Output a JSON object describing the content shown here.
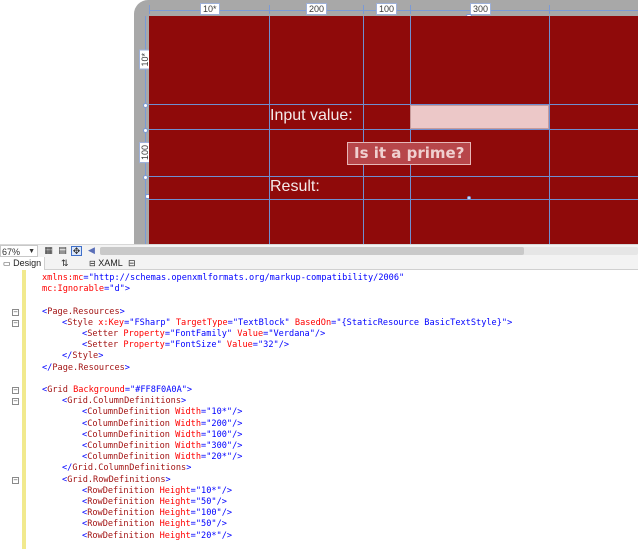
{
  "designer": {
    "column_widths": [
      "10*",
      "200",
      "100",
      "300"
    ],
    "row_heights": [
      "10*",
      "100"
    ],
    "input_label": "Input value:",
    "button_label": "Is it a prime?",
    "result_label": "Result:",
    "background_color": "#8f0a0a"
  },
  "toolbar": {
    "zoom": "67%",
    "fit_icon": "fit-to-window-icon",
    "grid_icon": "grid-icon",
    "snap_icon": "snap-to-grid-icon",
    "scroll_left_icon": "triangle-left-icon"
  },
  "view_tabs": {
    "design": "Design",
    "swap": "⇅",
    "xaml": "XAML",
    "collapse": "⊟"
  },
  "code": {
    "lines": [
      {
        "parts": [
          [
            "attr",
            "xmlns:mc"
          ],
          [
            "punct",
            "="
          ],
          [
            "val",
            "\"http://schemas.openxmlformats.org/markup-compatibility/2006\""
          ]
        ],
        "indent": 0
      },
      {
        "parts": [
          [
            "attr",
            "mc:Ignorable"
          ],
          [
            "punct",
            "="
          ],
          [
            "val",
            "\"d\""
          ],
          [
            "punct",
            ">"
          ]
        ],
        "indent": 0
      },
      {
        "parts": [],
        "indent": 0
      },
      {
        "parts": [
          [
            "punct",
            "<"
          ],
          [
            "tag",
            "Page.Resources"
          ],
          [
            "punct",
            ">"
          ]
        ],
        "indent": 0,
        "fold": true
      },
      {
        "parts": [
          [
            "punct",
            "<"
          ],
          [
            "tag",
            "Style"
          ],
          [
            "attr",
            " x:Key"
          ],
          [
            "punct",
            "="
          ],
          [
            "val",
            "\"FSharp\""
          ],
          [
            "attr",
            " TargetType"
          ],
          [
            "punct",
            "="
          ],
          [
            "val",
            "\"TextBlock\""
          ],
          [
            "attr",
            " BasedOn"
          ],
          [
            "punct",
            "="
          ],
          [
            "val",
            "\"{StaticResource BasicTextStyle}\""
          ],
          [
            "punct",
            ">"
          ]
        ],
        "indent": 1,
        "fold": true
      },
      {
        "parts": [
          [
            "punct",
            "<"
          ],
          [
            "tag",
            "Setter"
          ],
          [
            "attr",
            " Property"
          ],
          [
            "punct",
            "="
          ],
          [
            "val",
            "\"FontFamily\""
          ],
          [
            "attr",
            " Value"
          ],
          [
            "punct",
            "="
          ],
          [
            "val",
            "\"Verdana\""
          ],
          [
            "punct",
            "/>"
          ]
        ],
        "indent": 2
      },
      {
        "parts": [
          [
            "punct",
            "<"
          ],
          [
            "tag",
            "Setter"
          ],
          [
            "attr",
            " Property"
          ],
          [
            "punct",
            "="
          ],
          [
            "val",
            "\"FontSize\""
          ],
          [
            "attr",
            " Value"
          ],
          [
            "punct",
            "="
          ],
          [
            "val",
            "\"32\""
          ],
          [
            "punct",
            "/>"
          ]
        ],
        "indent": 2
      },
      {
        "parts": [
          [
            "punct",
            "</"
          ],
          [
            "tag",
            "Style"
          ],
          [
            "punct",
            ">"
          ]
        ],
        "indent": 1
      },
      {
        "parts": [
          [
            "punct",
            "</"
          ],
          [
            "tag",
            "Page.Resources"
          ],
          [
            "punct",
            ">"
          ]
        ],
        "indent": 0
      },
      {
        "parts": [],
        "indent": 0
      },
      {
        "parts": [
          [
            "punct",
            "<"
          ],
          [
            "tag",
            "Grid"
          ],
          [
            "attr",
            " Background"
          ],
          [
            "punct",
            "="
          ],
          [
            "val",
            "\"#FF8F0A0A\""
          ],
          [
            "punct",
            ">"
          ]
        ],
        "indent": 0,
        "fold": true
      },
      {
        "parts": [
          [
            "punct",
            "<"
          ],
          [
            "tag",
            "Grid.ColumnDefinitions"
          ],
          [
            "punct",
            ">"
          ]
        ],
        "indent": 1,
        "fold": true
      },
      {
        "parts": [
          [
            "punct",
            "<"
          ],
          [
            "tag",
            "ColumnDefinition"
          ],
          [
            "attr",
            " Width"
          ],
          [
            "punct",
            "="
          ],
          [
            "val",
            "\"10*\""
          ],
          [
            "punct",
            "/>"
          ]
        ],
        "indent": 2
      },
      {
        "parts": [
          [
            "punct",
            "<"
          ],
          [
            "tag",
            "ColumnDefinition"
          ],
          [
            "attr",
            " Width"
          ],
          [
            "punct",
            "="
          ],
          [
            "val",
            "\"200\""
          ],
          [
            "punct",
            "/>"
          ]
        ],
        "indent": 2
      },
      {
        "parts": [
          [
            "punct",
            "<"
          ],
          [
            "tag",
            "ColumnDefinition"
          ],
          [
            "attr",
            " Width"
          ],
          [
            "punct",
            "="
          ],
          [
            "val",
            "\"100\""
          ],
          [
            "punct",
            "/>"
          ]
        ],
        "indent": 2
      },
      {
        "parts": [
          [
            "punct",
            "<"
          ],
          [
            "tag",
            "ColumnDefinition"
          ],
          [
            "attr",
            " Width"
          ],
          [
            "punct",
            "="
          ],
          [
            "val",
            "\"300\""
          ],
          [
            "punct",
            "/>"
          ]
        ],
        "indent": 2
      },
      {
        "parts": [
          [
            "punct",
            "<"
          ],
          [
            "tag",
            "ColumnDefinition"
          ],
          [
            "attr",
            " Width"
          ],
          [
            "punct",
            "="
          ],
          [
            "val",
            "\"20*\""
          ],
          [
            "punct",
            "/>"
          ]
        ],
        "indent": 2
      },
      {
        "parts": [
          [
            "punct",
            "</"
          ],
          [
            "tag",
            "Grid.ColumnDefinitions"
          ],
          [
            "punct",
            ">"
          ]
        ],
        "indent": 1
      },
      {
        "parts": [
          [
            "punct",
            "<"
          ],
          [
            "tag",
            "Grid.RowDefinitions"
          ],
          [
            "punct",
            ">"
          ]
        ],
        "indent": 1,
        "fold": true
      },
      {
        "parts": [
          [
            "punct",
            "<"
          ],
          [
            "tag",
            "RowDefinition"
          ],
          [
            "attr",
            " Height"
          ],
          [
            "punct",
            "="
          ],
          [
            "val",
            "\"10*\""
          ],
          [
            "punct",
            "/>"
          ]
        ],
        "indent": 2
      },
      {
        "parts": [
          [
            "punct",
            "<"
          ],
          [
            "tag",
            "RowDefinition"
          ],
          [
            "attr",
            " Height"
          ],
          [
            "punct",
            "="
          ],
          [
            "val",
            "\"50\""
          ],
          [
            "punct",
            "/>"
          ]
        ],
        "indent": 2
      },
      {
        "parts": [
          [
            "punct",
            "<"
          ],
          [
            "tag",
            "RowDefinition"
          ],
          [
            "attr",
            " Height"
          ],
          [
            "punct",
            "="
          ],
          [
            "val",
            "\"100\""
          ],
          [
            "punct",
            "/>"
          ]
        ],
        "indent": 2
      },
      {
        "parts": [
          [
            "punct",
            "<"
          ],
          [
            "tag",
            "RowDefinition"
          ],
          [
            "attr",
            " Height"
          ],
          [
            "punct",
            "="
          ],
          [
            "val",
            "\"50\""
          ],
          [
            "punct",
            "/>"
          ]
        ],
        "indent": 2
      },
      {
        "parts": [
          [
            "punct",
            "<"
          ],
          [
            "tag",
            "RowDefinition"
          ],
          [
            "attr",
            " Height"
          ],
          [
            "punct",
            "="
          ],
          [
            "val",
            "\"20*\""
          ],
          [
            "punct",
            "/>"
          ]
        ],
        "indent": 2
      }
    ]
  }
}
